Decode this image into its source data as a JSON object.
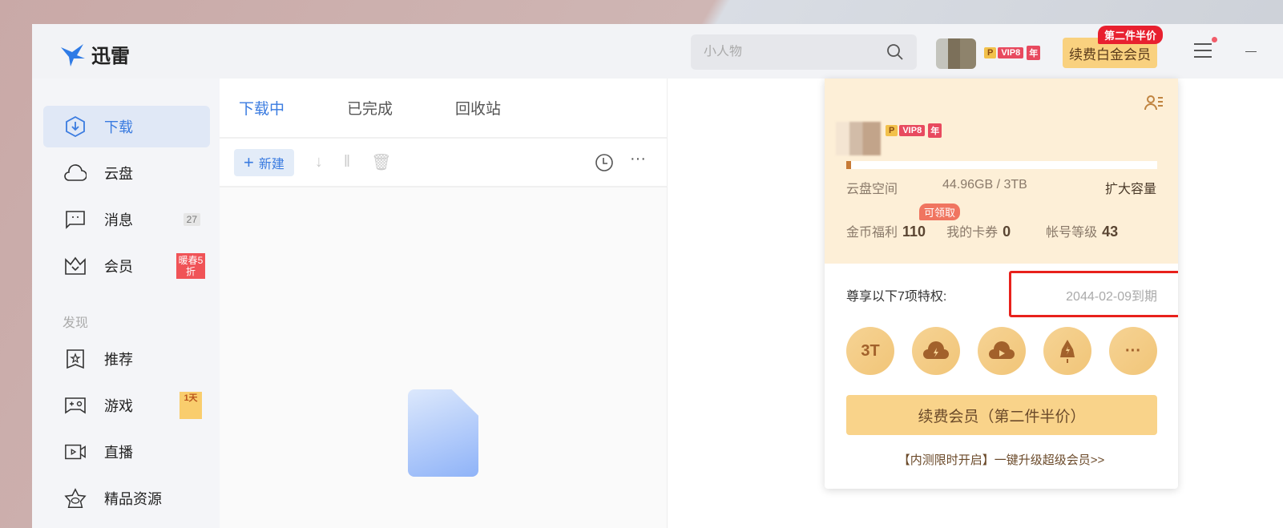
{
  "app": {
    "title": "迅雷"
  },
  "search": {
    "placeholder": "小人物"
  },
  "header": {
    "vip_p": "P",
    "vip_level": "VIP8",
    "vip_year": "年",
    "renew": "续费白金会员",
    "promo": "第二件半价"
  },
  "sidebar": {
    "items": [
      {
        "label": "下载"
      },
      {
        "label": "云盘"
      },
      {
        "label": "消息",
        "badge": "27"
      },
      {
        "label": "会员",
        "badge": "暖春5折"
      }
    ],
    "section": "发现",
    "discover": [
      {
        "label": "推荐"
      },
      {
        "label": "游戏",
        "badge": "1天"
      },
      {
        "label": "直播"
      },
      {
        "label": "精品资源"
      }
    ]
  },
  "tabs": [
    "下载中",
    "已完成",
    "回收站"
  ],
  "toolbar": {
    "new": "新建"
  },
  "popup": {
    "vip_p": "P",
    "vip_level": "VIP8",
    "vip_year": "年",
    "storage_fraction": 0.015,
    "storage_label": "云盘空间",
    "storage_value": "44.96GB / 3TB",
    "expand": "扩大容量",
    "coins_label": "金币福利",
    "coins": "110",
    "claim": "可领取",
    "coupons_label": "我的卡券",
    "coupons": "0",
    "level_label": "帐号等级",
    "level": "43",
    "privileges": "尊享以下7项特权:",
    "expire": "2044-02-09到期",
    "priv_icons": [
      "3T",
      "cloud-bolt-icon",
      "cloud-play-icon",
      "rocket-icon",
      "more-icon"
    ],
    "renew": "续费会员（第二件半价）",
    "upgrade": "【内测限时开启】一键升级超级会员>>"
  }
}
